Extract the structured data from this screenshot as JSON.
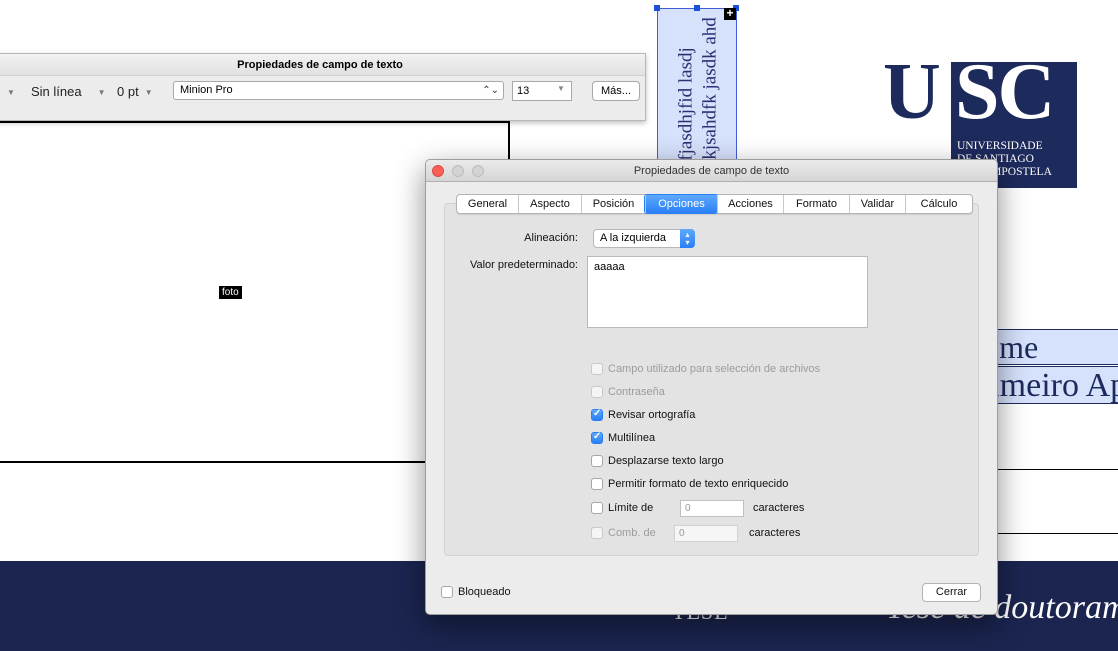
{
  "document": {
    "foto_label": "foto",
    "vertical_field_lines": [
      "jsadhfjasdhjfid lasdj",
      "sahdfkjsahdfk jasdk ahd"
    ],
    "logo": {
      "letters_left": "U",
      "letters_box": "SC",
      "subtitle_lines": [
        "UNIVERSIDADE",
        "DE SANTIAGO",
        "DE COMPOSTELA"
      ]
    },
    "name_field_1": "Nome",
    "name_field_2": "Primeiro Apelido",
    "footer_left": "TESE",
    "footer_right": "Tese de doutoramento"
  },
  "palette": {
    "title": "Propiedades de campo de texto",
    "line_style": "Sin línea",
    "line_width": "0 pt",
    "font": "Minion Pro",
    "font_size": "13",
    "more_button": "Más..."
  },
  "dialog": {
    "title": "Propiedades de campo de texto",
    "tabs": [
      {
        "label": "General",
        "active": false
      },
      {
        "label": "Aspecto",
        "active": false
      },
      {
        "label": "Posición",
        "active": false
      },
      {
        "label": "Opciones",
        "active": true
      },
      {
        "label": "Acciones",
        "active": false
      },
      {
        "label": "Formato",
        "active": false
      },
      {
        "label": "Validar",
        "active": false
      },
      {
        "label": "Cálculo",
        "active": false
      }
    ],
    "alignment_label": "Alineación:",
    "alignment_value": "A la izquierda",
    "default_value_label": "Valor predeterminado:",
    "default_value": "aaaaa",
    "options": {
      "file_select": {
        "label": "Campo utilizado para selección de archivos",
        "checked": false,
        "enabled": false
      },
      "password": {
        "label": "Contraseña",
        "checked": false,
        "enabled": false
      },
      "spell_check": {
        "label": "Revisar ortografía",
        "checked": true,
        "enabled": true
      },
      "multiline": {
        "label": "Multilínea",
        "checked": true,
        "enabled": true
      },
      "scroll_long": {
        "label": "Desplazarse texto largo",
        "checked": false,
        "enabled": true
      },
      "rich_text": {
        "label": "Permitir formato de texto enriquecido",
        "checked": false,
        "enabled": true
      },
      "limit": {
        "label": "Límite de",
        "value": "0",
        "suffix": "caracteres",
        "checked": false,
        "enabled": true
      },
      "comb": {
        "label": "Comb. de",
        "value": "0",
        "suffix": "caracteres",
        "checked": false,
        "enabled": false
      }
    },
    "locked_label": "Bloqueado",
    "close_button": "Cerrar"
  }
}
